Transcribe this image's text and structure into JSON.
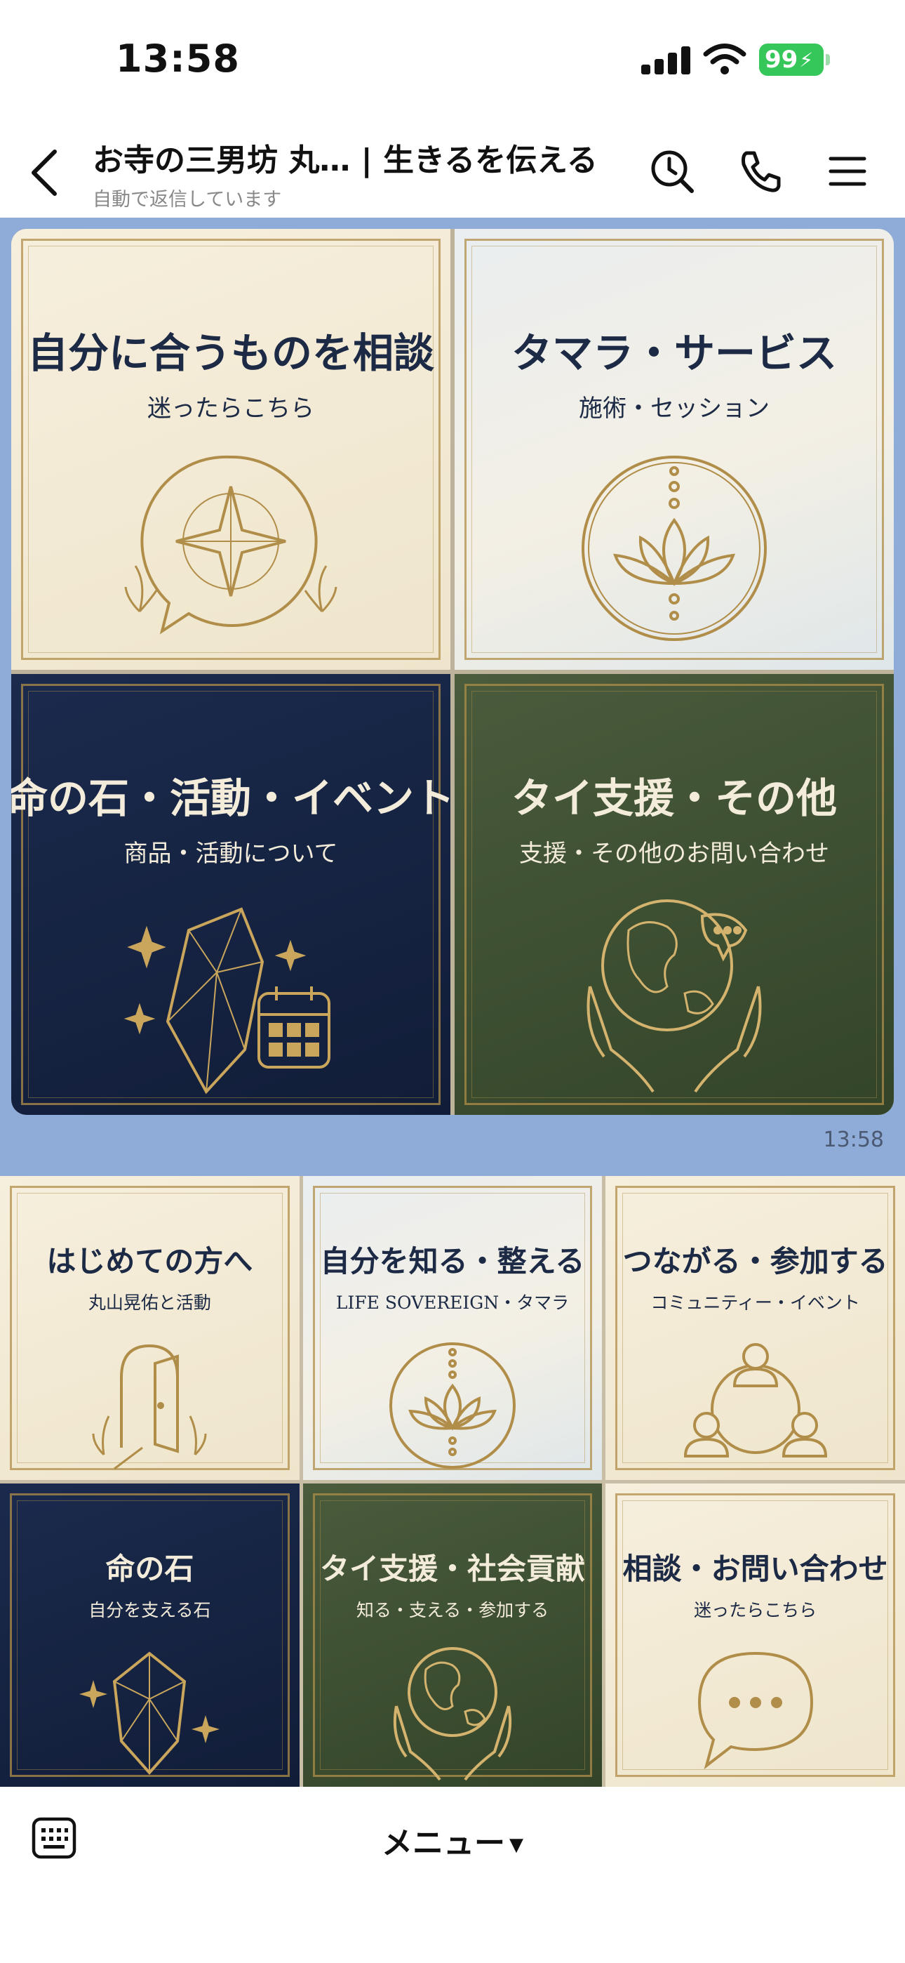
{
  "status": {
    "time": "13:58",
    "battery": "99"
  },
  "header": {
    "title": "お寺の三男坊 丸… | 生きるを伝える",
    "subtitle": "自動で返信しています"
  },
  "message": {
    "time": "13:58",
    "cards": [
      {
        "title": "自分に合うものを相談",
        "subtitle": "迷ったらこちら",
        "theme": "cream",
        "icon": "compass-icon"
      },
      {
        "title": "タマラ・サービス",
        "subtitle": "施術・セッション",
        "theme": "mist",
        "icon": "lotus-icon"
      },
      {
        "title": "命の石・活動・イベント",
        "subtitle": "商品・活動について",
        "theme": "navy",
        "icon": "crystal-calendar-icon"
      },
      {
        "title": "タイ支援・その他",
        "subtitle": "支援・その他のお問い合わせ",
        "theme": "green",
        "icon": "globe-hands-icon"
      }
    ]
  },
  "rich_menu": {
    "items": [
      {
        "title": "はじめての方へ",
        "subtitle": "丸山晃佑と活動",
        "theme": "cream",
        "icon": "door-icon"
      },
      {
        "title": "自分を知る・整える",
        "subtitle": "LIFE SOVEREIGN・タマラ",
        "theme": "mist",
        "icon": "lotus-icon"
      },
      {
        "title": "つながる・参加する",
        "subtitle": "コミュニティー・イベント",
        "theme": "cream",
        "icon": "people-icon"
      },
      {
        "title": "命の石",
        "subtitle": "自分を支える石",
        "theme": "navy",
        "icon": "crystal-icon"
      },
      {
        "title": "タイ支援・社会貢献",
        "subtitle": "知る・支える・参加する",
        "theme": "green",
        "icon": "globe-hands-icon"
      },
      {
        "title": "相談・お問い合わせ",
        "subtitle": "迷ったらこちら",
        "theme": "cream",
        "icon": "chat-bubble-icon"
      }
    ]
  },
  "bottom": {
    "menu_label": "メニュー"
  },
  "colors": {
    "chat_background": "#8fabd7",
    "gold": "#b08d48",
    "navy": "#14213f",
    "green": "#3d4f33",
    "cream": "#f3ead5"
  }
}
